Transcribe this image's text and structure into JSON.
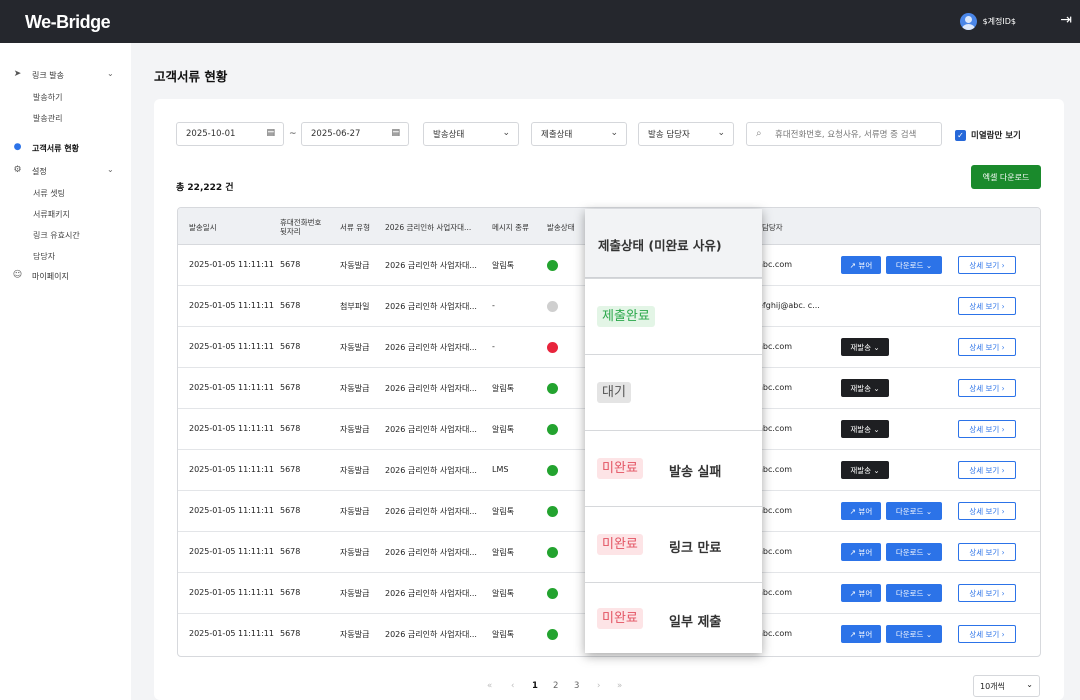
{
  "app": {
    "logo": "We-Bridge",
    "user_name": "$계정ID$"
  },
  "sidebar": {
    "link_send": "링크 발송",
    "link_send_items": [
      "발송하기",
      "발송관리"
    ],
    "customer_docs": "고객서류 현황",
    "settings": "설정",
    "settings_items": [
      "서류 셋팅",
      "서류패키지",
      "링크 유효시간",
      "담당자"
    ],
    "mypage": "마이페이지"
  },
  "page": {
    "title": "고객서류 현황"
  },
  "filters": {
    "date_from": "2025-10-01",
    "tilde": "~",
    "date_to": "2025-06-27",
    "send_status": "발송상태",
    "submit_status": "제출상태",
    "manager": "발송 담당자",
    "search_placeholder": "휴대전화번호, 요청사유, 서류명 중 검색",
    "unread_only": "미열람만 보기"
  },
  "summary": {
    "total": "총 22,222 건"
  },
  "actions": {
    "excel": "엑셀 다운로드"
  },
  "table": {
    "headers": {
      "sent_at": "발송일시",
      "phone": "휴대전화번호\n뒷자리",
      "doc_type": "서류 유형",
      "reason": "2026 금리인하 사업자대...",
      "msg_type": "메시지 종류",
      "send_status": "발송상태",
      "manager": "담당자"
    },
    "rows": [
      {
        "sent_at": "2025-01-05 11:11:11",
        "phone": "5678",
        "doc_type": "자동발급",
        "reason": "2026 금리인하 사업자대...",
        "msg": "알림톡",
        "status": "green",
        "email": "abc.com",
        "action": "view"
      },
      {
        "sent_at": "2025-01-05 11:11:11",
        "phone": "5678",
        "doc_type": "첨부파일",
        "reason": "2026 금리인하 사업자대...",
        "msg": "-",
        "status": "gray",
        "email": "efghij@abc. c...",
        "action": "none"
      },
      {
        "sent_at": "2025-01-05 11:11:11",
        "phone": "5678",
        "doc_type": "자동발급",
        "reason": "2026 금리인하 사업자대...",
        "msg": "-",
        "status": "red",
        "email": "abc.com",
        "action": "resend"
      },
      {
        "sent_at": "2025-01-05 11:11:11",
        "phone": "5678",
        "doc_type": "자동발급",
        "reason": "2026 금리인하 사업자대...",
        "msg": "알림톡",
        "status": "green",
        "email": "abc.com",
        "action": "resend"
      },
      {
        "sent_at": "2025-01-05 11:11:11",
        "phone": "5678",
        "doc_type": "자동발급",
        "reason": "2026 금리인하 사업자대...",
        "msg": "알림톡",
        "status": "green",
        "email": "abc.com",
        "action": "resend"
      },
      {
        "sent_at": "2025-01-05 11:11:11",
        "phone": "5678",
        "doc_type": "자동발급",
        "reason": "2026 금리인하 사업자대...",
        "msg": "LMS",
        "status": "green",
        "email": "abc.com",
        "action": "resend"
      },
      {
        "sent_at": "2025-01-05 11:11:11",
        "phone": "5678",
        "doc_type": "자동발급",
        "reason": "2026 금리인하 사업자대...",
        "msg": "알림톡",
        "status": "green",
        "email": "abc.com",
        "action": "view"
      },
      {
        "sent_at": "2025-01-05 11:11:11",
        "phone": "5678",
        "doc_type": "자동발급",
        "reason": "2026 금리인하 사업자대...",
        "msg": "알림톡",
        "status": "green",
        "email": "abc.com",
        "action": "view"
      },
      {
        "sent_at": "2025-01-05 11:11:11",
        "phone": "5678",
        "doc_type": "자동발급",
        "reason": "2026 금리인하 사업자대...",
        "msg": "알림톡",
        "status": "green",
        "email": "abc.com",
        "action": "view"
      },
      {
        "sent_at": "2025-01-05 11:11:11",
        "phone": "5678",
        "doc_type": "자동발급",
        "reason": "2026 금리인하 사업자대...",
        "msg": "알림톡",
        "status": "green",
        "email": "abc.com",
        "action": "view"
      }
    ],
    "buttons": {
      "view": "뷰어",
      "download": "다운로드",
      "resend": "재발송",
      "detail": "상세 보기"
    }
  },
  "popup": {
    "title": "제출상태 (미완료 사유)",
    "items": [
      {
        "badge": "제출완료",
        "style": "green",
        "reason": ""
      },
      {
        "badge": "대기",
        "style": "gray",
        "reason": ""
      },
      {
        "badge": "미완료",
        "style": "red",
        "reason": "발송 실패"
      },
      {
        "badge": "미완료",
        "style": "red",
        "reason": "링크 만료"
      },
      {
        "badge": "미완료",
        "style": "red",
        "reason": "일부 제출"
      }
    ]
  },
  "pagination": {
    "first": "«",
    "prev": "‹",
    "pages": [
      "1",
      "2",
      "3"
    ],
    "next": "›",
    "last": "»",
    "page_size": "10개씩"
  },
  "colors": {
    "green": "#23a32f",
    "gray": "#cfcfcf",
    "red": "#e8243c",
    "primary": "#2c73e8",
    "excel": "#1a8a2c"
  }
}
